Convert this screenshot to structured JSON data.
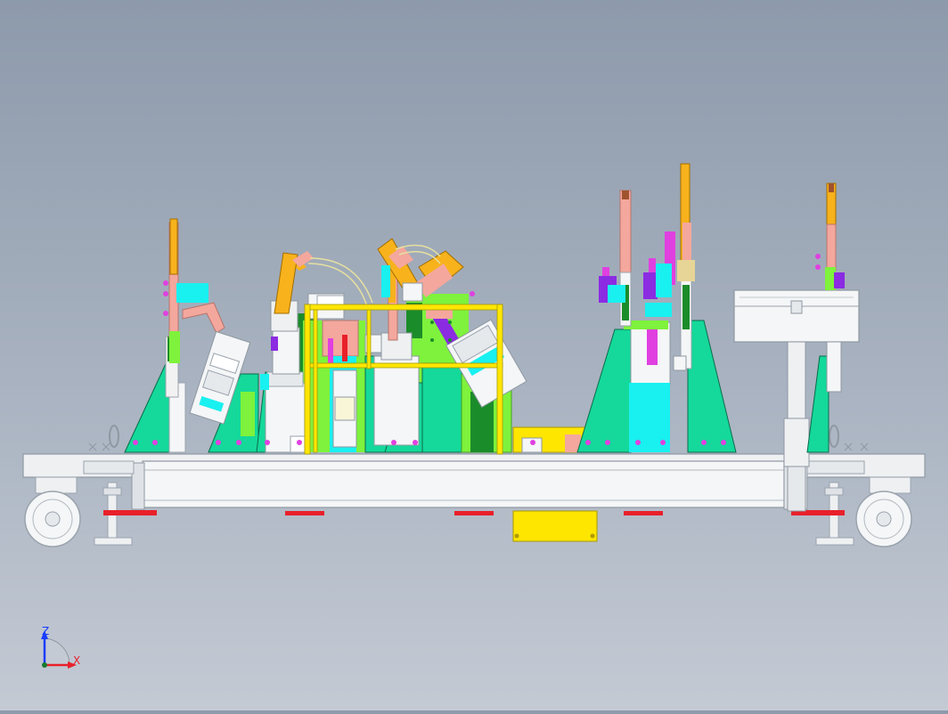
{
  "viewport": {
    "background_top": "#8d9aab",
    "background_bottom": "#c4cad4"
  },
  "colors": {
    "frame": "#eef0f2",
    "frame_stroke": "#9aa3ad",
    "gusset": "#14d99a",
    "bright_green": "#7ef23c",
    "dark_green": "#1b8c2a",
    "yellow": "#ffe600",
    "orange": "#f7b21c",
    "cyan": "#19f0f0",
    "salmon": "#f4a79d",
    "purple": "#8b2be2",
    "magenta": "#e040e0",
    "red_pad": "#e8202a",
    "steel": "#dfe3e7"
  },
  "triad": {
    "z_label": "Z",
    "x_label": "X",
    "z_color": "#1a3cff",
    "x_color": "#e8202a"
  }
}
